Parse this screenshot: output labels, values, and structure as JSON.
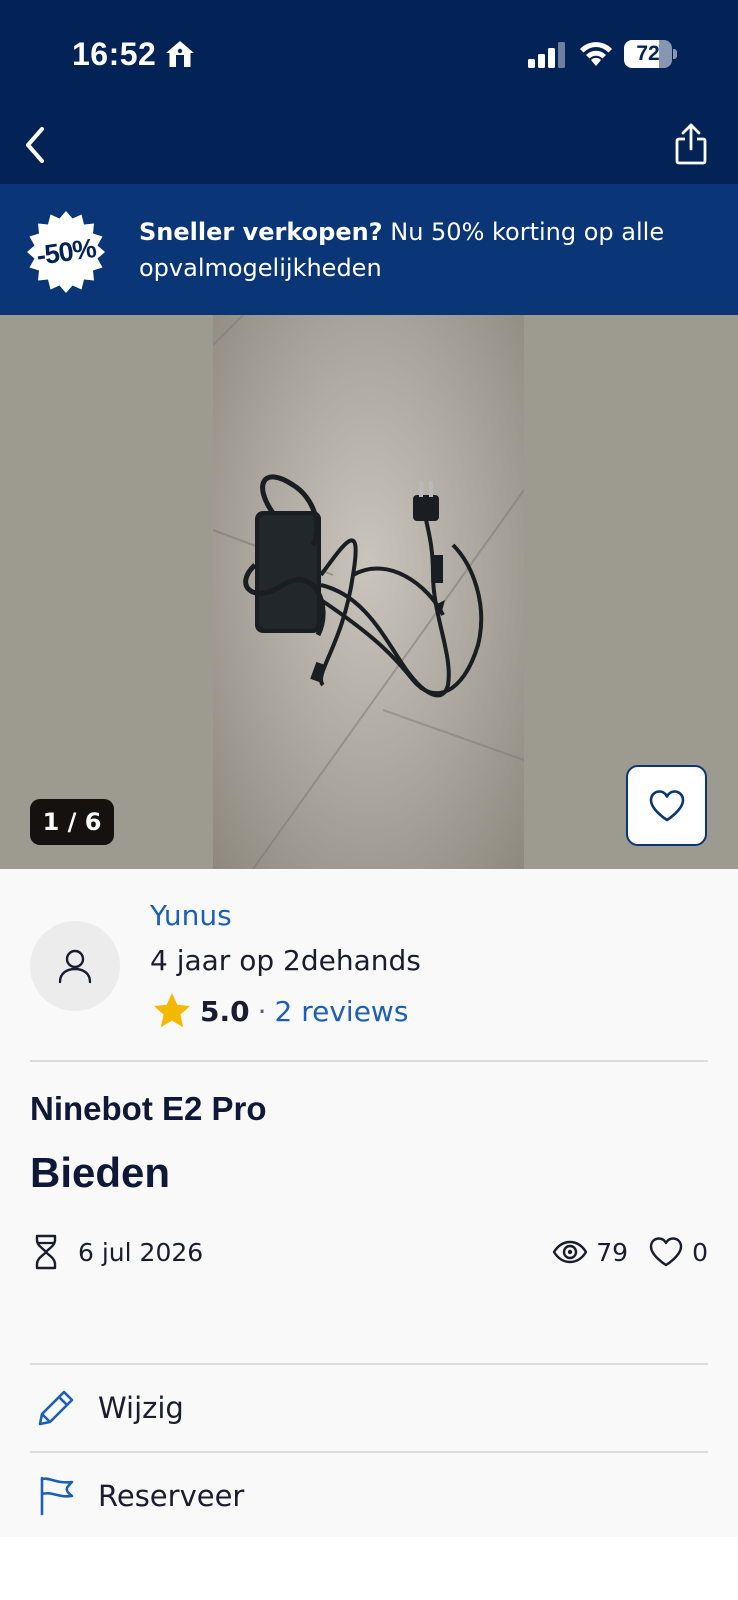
{
  "status_bar": {
    "time": "16:52",
    "battery": "72",
    "battery_level": 0.72,
    "icons": [
      "home-icon",
      "cellular-signal-icon",
      "wifi-icon",
      "battery-icon"
    ]
  },
  "nav": {
    "back_icon": "chevron-left-icon",
    "share_icon": "share-icon"
  },
  "promo": {
    "badge": "-50%",
    "bold": "Sneller verkopen?",
    "text": " Nu 50% korting op alle opvalmogelijkheden"
  },
  "gallery": {
    "counter": "1 / 6",
    "favorite_icon": "heart-icon"
  },
  "seller": {
    "name": "Yunus",
    "since": "4 jaar op 2dehands",
    "rating": "5.0",
    "separator": "·",
    "reviews": "2 reviews"
  },
  "listing": {
    "title": "Ninebot E2 Pro",
    "price": "Bieden",
    "date": "6 jul 2026",
    "views": "79",
    "favorites": "0"
  },
  "actions": {
    "edit_label": "Wijzig",
    "reserve_label": "Reserveer"
  },
  "colors": {
    "header_bg": "#032356",
    "banner_bg": "#0a3576",
    "link": "#1d5fb4",
    "star": "#f5b800"
  }
}
